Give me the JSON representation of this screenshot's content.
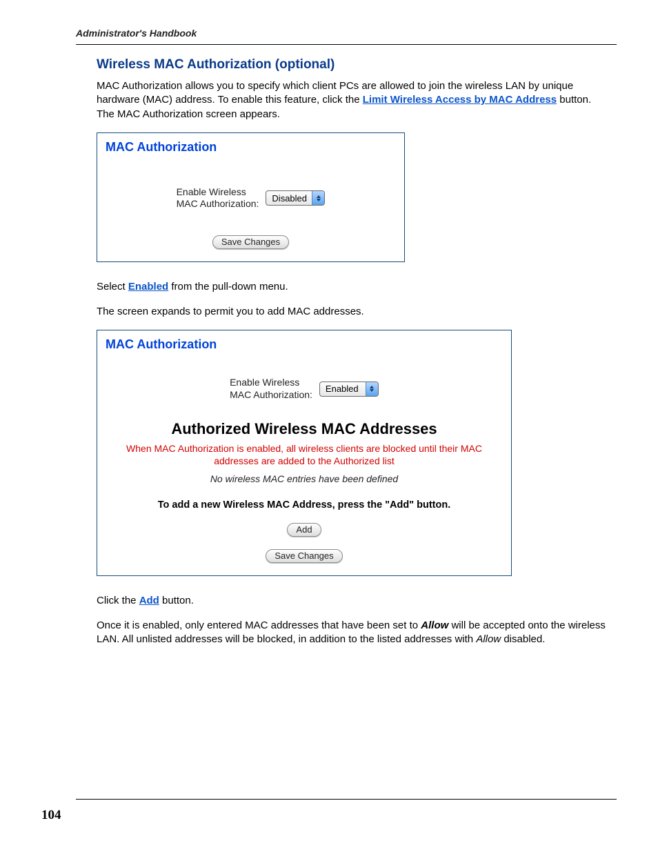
{
  "header": {
    "doc_title": "Administrator's Handbook"
  },
  "section": {
    "title": "Wireless MAC Authorization (optional)"
  },
  "intro": {
    "pre": "MAC Authorization allows you to specify which client PCs are allowed to join the wireless LAN by unique hardware (MAC) address. To enable this feature, click the ",
    "link": "Limit Wireless Access by MAC Address",
    "post": " button. The MAC Authorization screen appears."
  },
  "panel1": {
    "title": "MAC Authorization",
    "label": "Enable Wireless\nMAC Authorization:",
    "select_value": "Disabled",
    "save": "Save Changes"
  },
  "step1": {
    "pre": "Select ",
    "link": "Enabled",
    "post": " from the pull-down menu."
  },
  "step2": {
    "text": "The screen expands to permit you to add MAC addresses."
  },
  "panel2": {
    "title": "MAC Authorization",
    "label": "Enable Wireless\nMAC Authorization:",
    "select_value": "Enabled",
    "auth_heading": "Authorized Wireless MAC Addresses",
    "red_note": "When MAC Authorization is enabled, all wireless clients are blocked until their MAC addresses are added to the Authorized list",
    "empty_note": "No wireless MAC entries have been defined",
    "add_instr": "To add a new Wireless MAC Address, press the \"Add\" button.",
    "add": "Add",
    "save": "Save Changes"
  },
  "step3": {
    "pre": "Click the ",
    "link": "Add",
    "post": " button."
  },
  "closing": {
    "p1a": "Once it is enabled, only entered MAC addresses that have been set to ",
    "allow_b": "Allow",
    "p1b": " will be accepted onto the wireless LAN. All unlisted addresses will be blocked, in addition to the listed addresses with ",
    "allow_i": "Allow",
    "p1c": " disabled."
  },
  "page_number": "104"
}
